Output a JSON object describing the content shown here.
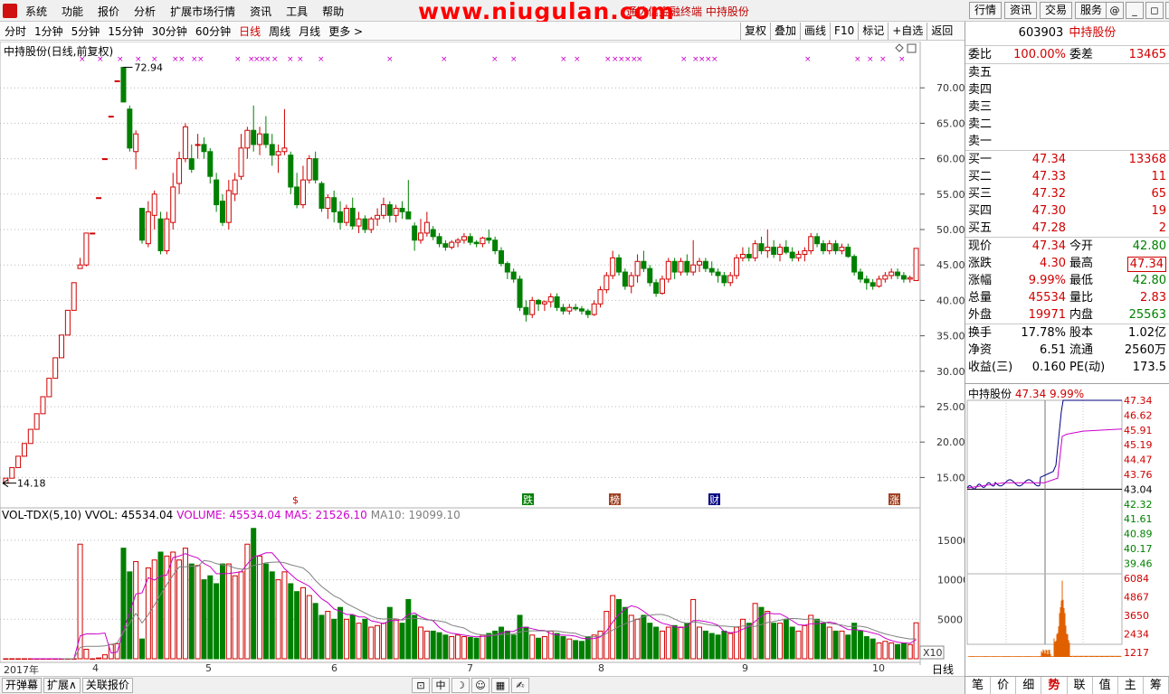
{
  "menu": {
    "items": [
      "系统",
      "功能",
      "报价",
      "分析",
      "扩展市场行情",
      "资讯",
      "工具",
      "帮助"
    ],
    "window_title": "通达信金融终端   中持股份",
    "watermark": "www.niugulan.com",
    "right_buttons": [
      "行情",
      "资讯",
      "交易",
      "服务"
    ],
    "window_controls": [
      "@",
      "_",
      "◻",
      "✕"
    ]
  },
  "periods": {
    "items": [
      "分时",
      "1分钟",
      "5分钟",
      "15分钟",
      "30分钟",
      "60分钟",
      "日线",
      "周线",
      "月线",
      "更多 >"
    ],
    "active": "日线",
    "tools": [
      "复权",
      "叠加",
      "画线",
      "F10",
      "标记",
      "+自选",
      "返回"
    ]
  },
  "chart": {
    "title": "中持股份(日线,前复权)",
    "high_label": "72.94",
    "low_label": "14.18",
    "y_ticks": [
      "70.00",
      "65.00",
      "60.00",
      "55.00",
      "50.00",
      "45.00",
      "40.00",
      "35.00",
      "30.00",
      "25.00",
      "20.00",
      "15.00"
    ],
    "event_markers": [
      "$",
      "跌",
      "榜",
      "财",
      "涨"
    ],
    "vol_title": {
      "part1": "VOL-TDX(5,10)  VVOL: 45534.04",
      "part2": "VOLUME: 45534.04  MA5: 21526.10",
      "part3": "MA10: 19099.10"
    },
    "vol_ticks": [
      "15000",
      "10000",
      "5000"
    ],
    "vol_unit": "X10",
    "date_labels": [
      "2017年",
      "4",
      "5",
      "6",
      "7",
      "8",
      "9",
      "10"
    ],
    "period_label": "日线"
  },
  "colors": {
    "up": "#d00000",
    "down": "#008000",
    "ma5": "#cc00cc",
    "ma10": "#808080"
  },
  "chart_data": {
    "type": "candlestick",
    "candles": [
      [
        14.2,
        14.9,
        14.2,
        14.9,
        0
      ],
      [
        14.9,
        16.4,
        14.9,
        16.4,
        0
      ],
      [
        16.4,
        18.0,
        16.4,
        18.0,
        0
      ],
      [
        18.0,
        19.8,
        18.0,
        19.8,
        0
      ],
      [
        19.8,
        21.8,
        19.8,
        21.8,
        0
      ],
      [
        21.8,
        24.0,
        21.8,
        24.0,
        0
      ],
      [
        24.0,
        26.4,
        24.0,
        26.4,
        0
      ],
      [
        26.4,
        29.0,
        26.4,
        29.0,
        0
      ],
      [
        29.0,
        31.9,
        29.0,
        31.9,
        0
      ],
      [
        31.9,
        35.1,
        31.9,
        35.1,
        0
      ],
      [
        35.1,
        38.6,
        35.1,
        38.6,
        0
      ],
      [
        38.6,
        42.5,
        38.6,
        42.5,
        0
      ],
      [
        44.5,
        46.0,
        44.5,
        45.0,
        14500
      ],
      [
        45.0,
        49.5,
        44.8,
        49.5,
        1200
      ],
      [
        49.5,
        49.5,
        49.5,
        49.5,
        0
      ],
      [
        54.5,
        54.5,
        54.5,
        54.5,
        100
      ],
      [
        60.0,
        60.0,
        60.0,
        60.0,
        500
      ],
      [
        66.0,
        66.0,
        66.0,
        66.0,
        1800
      ],
      [
        71.0,
        71.0,
        71.0,
        71.0,
        1900
      ],
      [
        72.9,
        72.9,
        68.0,
        68.0,
        14000
      ],
      [
        67.0,
        67.5,
        61.0,
        61.5,
        11000
      ],
      [
        61.0,
        64.0,
        58.5,
        63.5,
        12300
      ],
      [
        53.0,
        53.0,
        48.0,
        48.5,
        2500
      ],
      [
        48.0,
        54.0,
        47.5,
        52.5,
        11500
      ],
      [
        52.0,
        55.5,
        50.0,
        55.0,
        12500
      ],
      [
        51.5,
        52.5,
        46.5,
        47.0,
        13500
      ],
      [
        47.0,
        52.5,
        46.5,
        51.5,
        13000
      ],
      [
        51.0,
        58.0,
        50.0,
        56.0,
        13500
      ],
      [
        56.5,
        61.0,
        55.0,
        60.0,
        12500
      ],
      [
        60.0,
        65.0,
        59.5,
        64.5,
        14000
      ],
      [
        60.0,
        62.0,
        58.0,
        58.5,
        12000
      ],
      [
        62.0,
        63.5,
        60.0,
        62.0,
        11800
      ],
      [
        62.0,
        63.0,
        60.0,
        61.0,
        10000
      ],
      [
        61.0,
        61.5,
        56.5,
        57.5,
        10500
      ],
      [
        57.0,
        58.0,
        52.5,
        53.5,
        9500
      ],
      [
        54.0,
        55.0,
        50.5,
        51.0,
        12000
      ],
      [
        51.0,
        57.0,
        50.0,
        55.5,
        12000
      ],
      [
        55.0,
        58.0,
        54.0,
        57.0,
        10500
      ],
      [
        57.5,
        63.5,
        57.0,
        61.5,
        11000
      ],
      [
        61.5,
        64.5,
        60.0,
        64.0,
        14500
      ],
      [
        64.0,
        67.5,
        61.0,
        62.0,
        16500
      ],
      [
        62.0,
        64.5,
        60.5,
        63.5,
        13000
      ],
      [
        63.5,
        66.0,
        61.5,
        62.0,
        12000
      ],
      [
        62.0,
        63.5,
        59.0,
        60.5,
        11000
      ],
      [
        60.5,
        62.0,
        58.0,
        61.0,
        10000
      ],
      [
        61.0,
        67.0,
        60.5,
        61.5,
        11000
      ],
      [
        60.5,
        61.0,
        55.0,
        56.0,
        9500
      ],
      [
        56.0,
        58.0,
        53.0,
        53.5,
        8500
      ],
      [
        53.5,
        59.0,
        53.0,
        57.0,
        9000
      ],
      [
        57.0,
        60.5,
        56.5,
        60.0,
        8000
      ],
      [
        60.0,
        61.0,
        56.5,
        57.0,
        7000
      ],
      [
        56.5,
        56.8,
        52.5,
        53.0,
        5500
      ],
      [
        53.0,
        55.0,
        51.5,
        54.5,
        6000
      ],
      [
        54.5,
        55.5,
        51.0,
        52.5,
        5000
      ],
      [
        52.5,
        54.0,
        50.0,
        51.0,
        6500
      ],
      [
        51.0,
        53.5,
        50.5,
        53.0,
        5000
      ],
      [
        53.0,
        54.5,
        50.0,
        50.5,
        5500
      ],
      [
        50.5,
        52.5,
        49.5,
        51.5,
        4500
      ],
      [
        51.5,
        52.0,
        49.5,
        50.0,
        5000
      ],
      [
        50.0,
        51.8,
        49.5,
        51.5,
        4000
      ],
      [
        51.5,
        53.0,
        50.5,
        52.0,
        4200
      ],
      [
        52.0,
        54.5,
        51.5,
        53.5,
        4500
      ],
      [
        53.5,
        54.0,
        51.0,
        52.0,
        6500
      ],
      [
        52.0,
        53.5,
        51.0,
        53.0,
        5000
      ],
      [
        53.0,
        54.0,
        51.5,
        52.5,
        4500
      ],
      [
        52.5,
        57.0,
        51.5,
        51.5,
        7500
      ],
      [
        50.5,
        51.0,
        47.0,
        48.5,
        5500
      ],
      [
        48.5,
        51.5,
        48.0,
        49.5,
        4000
      ],
      [
        49.5,
        52.5,
        49.0,
        51.0,
        3500
      ],
      [
        50.0,
        50.5,
        48.5,
        49.0,
        3500
      ],
      [
        49.0,
        49.5,
        47.5,
        48.0,
        3300
      ],
      [
        48.0,
        48.5,
        47.0,
        47.5,
        3000
      ],
      [
        47.5,
        48.5,
        47.2,
        48.2,
        2800
      ],
      [
        48.2,
        48.8,
        47.5,
        48.5,
        3000
      ],
      [
        48.5,
        49.5,
        48.0,
        49.0,
        2800
      ],
      [
        49.0,
        49.5,
        47.8,
        48.2,
        2700
      ],
      [
        48.2,
        48.5,
        47.5,
        48.0,
        2600
      ],
      [
        48.0,
        49.0,
        47.5,
        48.8,
        3000
      ],
      [
        48.8,
        50.0,
        48.0,
        48.5,
        3200
      ],
      [
        48.5,
        49.0,
        46.5,
        47.0,
        3500
      ],
      [
        47.0,
        47.5,
        44.8,
        45.2,
        4000
      ],
      [
        45.2,
        45.5,
        43.0,
        44.0,
        3500
      ],
      [
        44.0,
        44.5,
        42.5,
        43.0,
        3000
      ],
      [
        43.0,
        43.5,
        38.5,
        39.0,
        5500
      ],
      [
        39.0,
        40.0,
        37.0,
        38.0,
        4000
      ],
      [
        38.0,
        40.5,
        37.5,
        40.0,
        3000
      ],
      [
        40.0,
        40.2,
        38.5,
        39.5,
        2600
      ],
      [
        39.5,
        40.0,
        38.5,
        39.8,
        2800
      ],
      [
        39.8,
        41.0,
        39.0,
        40.5,
        3500
      ],
      [
        40.5,
        41.0,
        38.5,
        39.0,
        3200
      ],
      [
        39.0,
        39.5,
        38.0,
        38.5,
        2800
      ],
      [
        38.5,
        39.5,
        38.0,
        39.0,
        2500
      ],
      [
        39.0,
        39.5,
        38.5,
        38.8,
        2300
      ],
      [
        38.8,
        39.2,
        38.0,
        38.5,
        2200
      ],
      [
        38.5,
        38.8,
        37.5,
        38.0,
        2800
      ],
      [
        38.0,
        40.0,
        37.8,
        39.5,
        3000
      ],
      [
        39.5,
        42.0,
        39.0,
        41.5,
        3500
      ],
      [
        41.5,
        44.0,
        41.0,
        43.5,
        6000
      ],
      [
        43.5,
        47.0,
        43.0,
        46.0,
        8000
      ],
      [
        46.0,
        46.5,
        43.5,
        44.0,
        7500
      ],
      [
        44.0,
        44.5,
        41.5,
        42.0,
        6500
      ],
      [
        42.0,
        44.0,
        41.0,
        43.5,
        5500
      ],
      [
        43.5,
        46.5,
        42.5,
        45.5,
        5000
      ],
      [
        45.5,
        47.0,
        44.0,
        44.5,
        5500
      ],
      [
        44.5,
        45.0,
        42.0,
        42.5,
        4500
      ],
      [
        42.5,
        43.0,
        40.5,
        41.0,
        4000
      ],
      [
        41.0,
        43.5,
        40.8,
        43.0,
        3500
      ],
      [
        43.0,
        46.0,
        42.5,
        45.5,
        4000
      ],
      [
        45.5,
        46.0,
        43.0,
        44.0,
        4200
      ],
      [
        44.0,
        46.0,
        43.5,
        45.5,
        4000
      ],
      [
        45.5,
        46.5,
        43.5,
        44.0,
        4500
      ],
      [
        44.0,
        48.5,
        43.5,
        45.0,
        7500
      ],
      [
        45.0,
        46.0,
        44.0,
        45.5,
        4000
      ],
      [
        45.5,
        46.0,
        44.0,
        44.5,
        3500
      ],
      [
        44.5,
        45.5,
        43.5,
        44.0,
        3200
      ],
      [
        44.0,
        44.5,
        42.5,
        43.5,
        3000
      ],
      [
        43.5,
        44.0,
        42.0,
        42.5,
        3500
      ],
      [
        42.5,
        44.0,
        42.0,
        43.5,
        3200
      ],
      [
        43.5,
        46.5,
        43.0,
        46.0,
        4000
      ],
      [
        46.0,
        47.5,
        45.5,
        46.5,
        5000
      ],
      [
        46.5,
        47.5,
        45.5,
        46.0,
        4500
      ],
      [
        46.0,
        48.5,
        45.5,
        48.0,
        7000
      ],
      [
        48.0,
        49.0,
        46.5,
        47.0,
        6500
      ],
      [
        47.0,
        50.0,
        46.0,
        47.5,
        6000
      ],
      [
        47.5,
        48.5,
        46.0,
        46.5,
        4500
      ],
      [
        46.5,
        48.0,
        45.5,
        47.5,
        4500
      ],
      [
        47.5,
        48.5,
        46.5,
        46.8,
        5000
      ],
      [
        46.8,
        47.5,
        45.5,
        46.0,
        4000
      ],
      [
        46.0,
        47.0,
        45.5,
        46.5,
        3500
      ],
      [
        46.5,
        47.5,
        45.5,
        47.0,
        4200
      ],
      [
        47.0,
        49.5,
        46.5,
        49.0,
        5500
      ],
      [
        49.0,
        49.5,
        47.5,
        48.0,
        5000
      ],
      [
        48.0,
        48.5,
        46.5,
        47.0,
        4500
      ],
      [
        47.0,
        48.5,
        46.5,
        48.0,
        4000
      ],
      [
        48.0,
        48.5,
        46.5,
        47.0,
        3500
      ],
      [
        47.0,
        48.0,
        46.5,
        47.5,
        3500
      ],
      [
        47.5,
        48.0,
        46.0,
        46.2,
        3000
      ],
      [
        46.2,
        46.5,
        43.5,
        44.0,
        4500
      ],
      [
        44.0,
        44.5,
        42.5,
        43.0,
        3500
      ],
      [
        43.0,
        43.5,
        41.5,
        42.5,
        2800
      ],
      [
        42.5,
        43.0,
        41.5,
        42.0,
        2500
      ],
      [
        42.0,
        43.5,
        41.8,
        43.0,
        2000
      ],
      [
        43.0,
        44.0,
        42.5,
        43.5,
        2200
      ],
      [
        43.5,
        44.5,
        43.0,
        44.0,
        2000
      ],
      [
        44.0,
        44.5,
        43.0,
        43.5,
        1800
      ],
      [
        43.5,
        44.0,
        42.5,
        43.0,
        2000
      ],
      [
        43.0,
        43.5,
        42.5,
        43.2,
        1800
      ],
      [
        42.8,
        47.34,
        42.8,
        47.34,
        4550
      ]
    ],
    "price_axis": [
      12.5,
      75
    ],
    "volume_axis": [
      0,
      17500
    ],
    "minute_price_axis": [
      43.04,
      47.34
    ]
  },
  "quote": {
    "code": "603903",
    "name": "中持股份",
    "weibi_label": "委比",
    "weibi": "100.00%",
    "weicha_label": "委差",
    "weicha": "13465",
    "sells": [
      {
        "label": "卖五",
        "price": "",
        "vol": ""
      },
      {
        "label": "卖四",
        "price": "",
        "vol": ""
      },
      {
        "label": "卖三",
        "price": "",
        "vol": ""
      },
      {
        "label": "卖二",
        "price": "",
        "vol": ""
      },
      {
        "label": "卖一",
        "price": "",
        "vol": ""
      }
    ],
    "buys": [
      {
        "label": "买一",
        "price": "47.34",
        "vol": "13368"
      },
      {
        "label": "买二",
        "price": "47.33",
        "vol": "11"
      },
      {
        "label": "买三",
        "price": "47.32",
        "vol": "65"
      },
      {
        "label": "买四",
        "price": "47.30",
        "vol": "19"
      },
      {
        "label": "买五",
        "price": "47.28",
        "vol": "2"
      }
    ],
    "stats1": [
      {
        "l1": "现价",
        "v1": "47.34",
        "l2": "今开",
        "v2": "42.80"
      },
      {
        "l1": "涨跌",
        "v1": "4.30",
        "l2": "最高",
        "v2": "47.34"
      },
      {
        "l1": "涨幅",
        "v1": "9.99%",
        "l2": "最低",
        "v2": "42.80"
      },
      {
        "l1": "总量",
        "v1": "45534",
        "l2": "量比",
        "v2": "2.83"
      },
      {
        "l1": "外盘",
        "v1": "19971",
        "l2": "内盘",
        "v2": "25563"
      }
    ],
    "stats2": [
      {
        "l1": "换手",
        "v1": "17.78%",
        "l2": "股本",
        "v2": "1.02亿"
      },
      {
        "l1": "净资",
        "v1": "6.51",
        "l2": "流通",
        "v2": "2560万"
      },
      {
        "l1": "收益(三)",
        "v1": "0.160",
        "l2": "PE(动)",
        "v2": "173.5"
      }
    ]
  },
  "minute": {
    "header_name": "中持股份",
    "header_price": "47.34",
    "header_pct": "9.99%",
    "price_ticks": [
      "47.34",
      "46.62",
      "45.91",
      "45.19",
      "44.47",
      "43.76",
      "43.04",
      "42.32",
      "41.61",
      "40.89",
      "40.17",
      "39.46"
    ],
    "vol_ticks": [
      "6084",
      "4867",
      "3650",
      "2434",
      "1217"
    ],
    "tabs": [
      "笔",
      "价",
      "细",
      "势",
      "联",
      "值",
      "主",
      "筹"
    ],
    "active_tab": "势"
  },
  "bottom": {
    "buttons": [
      "开弹幕",
      "扩展∧",
      "关联报价"
    ],
    "icons": [
      "⊡",
      "中",
      "☽",
      "☺",
      "▦",
      "✍"
    ]
  }
}
